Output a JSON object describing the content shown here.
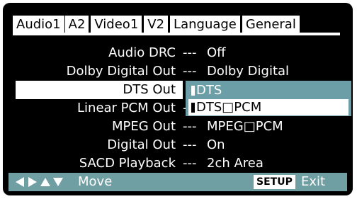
{
  "tabs": [
    {
      "label": "Audio1",
      "active": true
    },
    {
      "label": "A2"
    },
    {
      "label": "Video1"
    },
    {
      "label": "V2"
    },
    {
      "label": "Language"
    },
    {
      "label": "General"
    }
  ],
  "settings": [
    {
      "label": "Audio DRC",
      "sep": "---",
      "value": "Off"
    },
    {
      "label": "Dolby Digital Out",
      "sep": "---",
      "value": "Dolby Digital"
    },
    {
      "label": "DTS Out",
      "sep": "",
      "value": ""
    },
    {
      "label": "Linear PCM Out",
      "sep": "-",
      "value": ""
    },
    {
      "label": "MPEG Out",
      "sep": "---",
      "value": "MPEG□PCM"
    },
    {
      "label": "Digital Out",
      "sep": "---",
      "value": "On"
    },
    {
      "label": "SACD Playback",
      "sep": "---",
      "value": "2ch Area"
    }
  ],
  "dropdown": {
    "options": [
      "DTS",
      "DTS□PCM"
    ],
    "selected": "DTS"
  },
  "footer": {
    "move_label": "Move",
    "setup_label": "SETUP",
    "exit_label": "Exit",
    "arrow_icons": [
      "left-arrow-icon",
      "right-arrow-icon",
      "up-arrow-icon",
      "down-arrow-icon"
    ]
  },
  "colors": {
    "background": "#000000",
    "accent": "#6b9ea6",
    "text": "#ffffff"
  }
}
